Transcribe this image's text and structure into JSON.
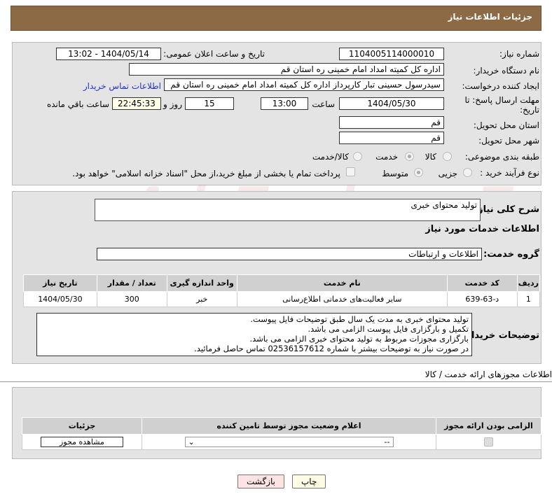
{
  "header": {
    "title": "جزئیات اطلاعات نیاز"
  },
  "fields": {
    "need_number_label": "شماره نیاز:",
    "need_number": "1104005114000010",
    "announce_label": "تاریخ و ساعت اعلان عمومی:",
    "announce_value": "1404/05/14 - 13:02",
    "buyer_label": "نام دستگاه خریدار:",
    "buyer": "اداره کل کمیته امداد امام خمینی  ره  استان قم",
    "creator_label": "ایجاد کننده درخواست:",
    "creator": "سیدرسول حسینی تبار کارپرداز اداره کل کمیته امداد امام خمینی  ره  استان قم",
    "contact_link": "اطلاعات تماس خریدار",
    "deadline_label": "مهلت ارسال پاسخ: تا تاریخ:",
    "deadline_date": "1404/05/30",
    "time_label": "ساعت",
    "deadline_time": "13:00",
    "days": "15",
    "days_label": "روز و",
    "remaining": "22:45:33",
    "remaining_label": "ساعت باقي مانده",
    "province_label": "استان محل تحویل:",
    "province": "قم",
    "city_label": "شهر محل تحویل:",
    "city": "قم",
    "category_label": "طبقه بندی موضوعی:",
    "cat_options": [
      "کالا",
      "خدمت",
      "کالا/خدمت"
    ],
    "process_label": "نوع فرآیند خرید :",
    "process_options": [
      "جزیی",
      "متوسط"
    ],
    "payment_text": "پرداخت تمام یا بخشی از مبلغ خرید،از محل \"اسناد خزانه اسلامی\" خواهد بود."
  },
  "summary": {
    "label": "شرح کلی نیاز:",
    "value": "تولید محتوای خبری",
    "services_title": "اطلاعات خدمات مورد نیاز",
    "group_label": "گروه خدمت:",
    "group": "اطلاعات و ارتباطات"
  },
  "table": {
    "headers": [
      "ردیف",
      "کد خدمت",
      "نام خدمت",
      "واحد اندازه گیری",
      "تعداد / مقدار",
      "تاریخ نیاز"
    ],
    "rows": [
      [
        "1",
        "د-63-639",
        "سایر فعالیت‌های خدماتی اطلاع‌رسانی",
        "خبر",
        "300",
        "1404/05/30"
      ]
    ]
  },
  "notes": {
    "label": "توضیحات خریدار:",
    "lines": [
      "تولید محتوای خبری به مدت یک سال طبق توضیحات فایل پیوست.",
      "تکمیل و بارگزاری فایل پیوست الزامی می باشد.",
      "بارگزاری مجوزات مربوط به تولید محتوای خبری الزامی می باشد.",
      "در صورت نیاز به توضیحات بیشتر با شماره 02536157612 تماس حاصل فرمائید."
    ]
  },
  "permits": {
    "title": "اطلاعات مجوزهای ارائه خدمت / کالا",
    "headers": [
      "الزامی بودن ارائه مجوز",
      "اعلام وضعیت مجوز توسط تامین کننده",
      "جزئیات"
    ],
    "select_value": "--",
    "view_button": "مشاهده مجوز"
  },
  "buttons": {
    "print": "چاپ",
    "back": "بازگشت"
  },
  "watermark": "AriaTender.neT"
}
